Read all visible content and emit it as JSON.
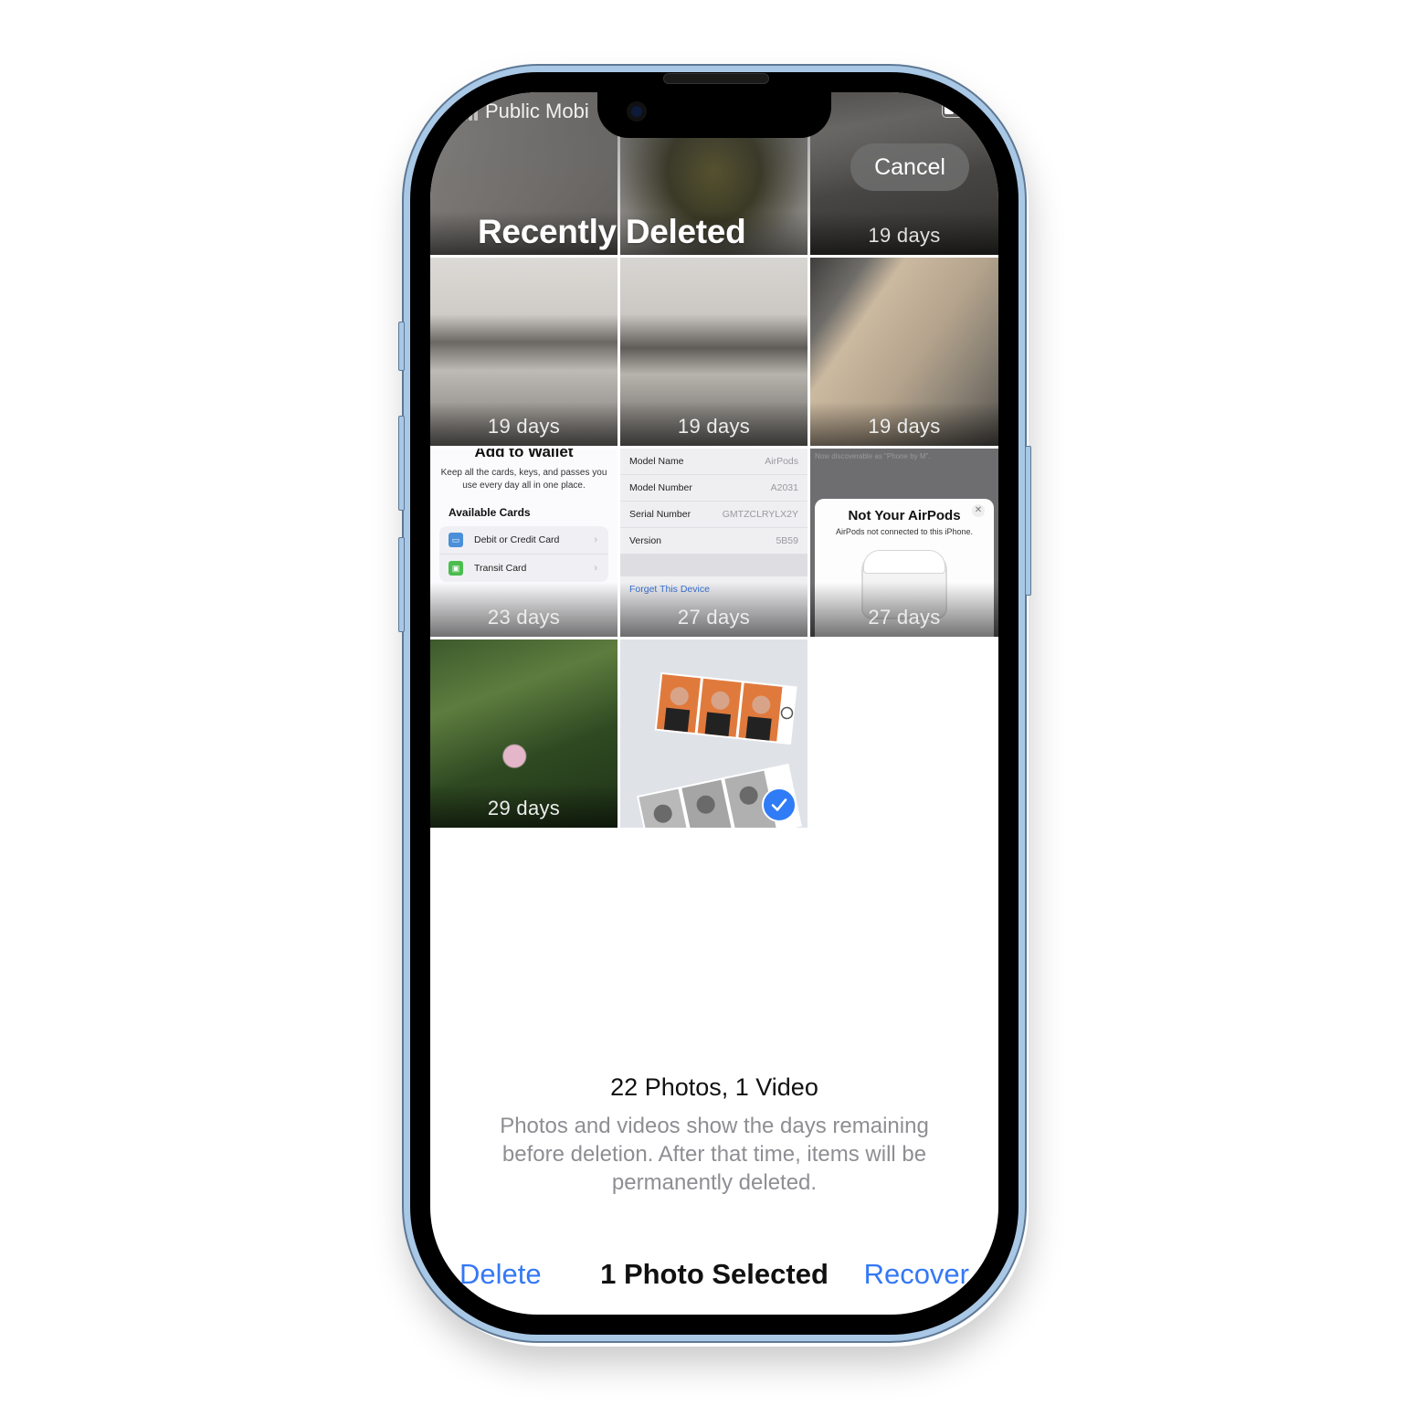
{
  "status_bar": {
    "carrier": "Public Mobi",
    "signal_bars": 4,
    "battery_icon": "battery-icon"
  },
  "header": {
    "title": "Recently Deleted",
    "cancel_label": "Cancel"
  },
  "photos": [
    {
      "days": "",
      "desc": "plastic containers"
    },
    {
      "days": "",
      "desc": "glass jar"
    },
    {
      "days": "19 days",
      "desc": "ceiling fixture"
    },
    {
      "days": "19 days",
      "desc": "ceiling light spring clip"
    },
    {
      "days": "19 days",
      "desc": "ceiling light spring clip"
    },
    {
      "days": "19 days",
      "desc": "blurred floor"
    },
    {
      "days": "23 days",
      "desc": "Add to Wallet screenshot"
    },
    {
      "days": "27 days",
      "desc": "AirPods info screenshot"
    },
    {
      "days": "27 days",
      "desc": "Not Your AirPods screenshot"
    },
    {
      "days": "29 days",
      "desc": "hibiscus flower"
    },
    {
      "days": "",
      "desc": "photo booth strips",
      "selected": true
    }
  ],
  "wallet_shot": {
    "title": "Add to Wallet",
    "description": "Keep all the cards, keys, and passes you use every day all in one place.",
    "heading": "Available Cards",
    "items": [
      {
        "label": "Debit or Credit Card",
        "icon": "credit-card-icon",
        "color": "#4a8fd8"
      },
      {
        "label": "Transit Card",
        "icon": "train-icon",
        "color": "#4bbd4f"
      }
    ]
  },
  "airpods_shot": {
    "rows": [
      {
        "key": "Model Name",
        "value": "AirPods"
      },
      {
        "key": "Model Number",
        "value": "A2031"
      },
      {
        "key": "Serial Number",
        "value": "GMTZCLRYLX2Y"
      },
      {
        "key": "Version",
        "value": "5B59"
      }
    ],
    "link": "Forget This Device"
  },
  "not_yours_shot": {
    "background_text": "Now discoverable as \"Phone by M\".",
    "title": "Not Your AirPods",
    "subtitle": "AirPods not connected to this iPhone."
  },
  "summary": {
    "count": "22 Photos, 1 Video",
    "explanation": "Photos and videos show the days remaining before deletion. After that time, items will be permanently deleted."
  },
  "toolbar": {
    "delete_label": "Delete",
    "selection_label": "1 Photo Selected",
    "recover_label": "Recover"
  },
  "colors": {
    "accent": "#3478f6",
    "frame": "#a9c8e6",
    "selected_badge": "#2f7cf6"
  }
}
